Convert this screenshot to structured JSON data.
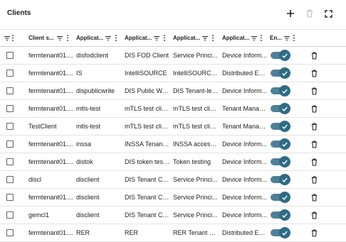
{
  "title": "Clients",
  "toolbar": {
    "add_icon": "plus-icon",
    "delete_icon": "trash-icon",
    "fullscreen_icon": "fullscreen-icon"
  },
  "columns": [
    "Client s...",
    "Applicat...",
    "Applicat...",
    "Applicat...",
    "Applicat...",
    "En..."
  ],
  "colors": {
    "toggle_track": "#4e8098",
    "toggle_knob": "#2f6b85"
  },
  "rows": [
    {
      "client": "fermtenant01....",
      "app_id": "disfodclient",
      "app_name": "DIS FOD Client",
      "app_desc": "Service Princi...",
      "app_sys": "Device Inform...",
      "enabled": true
    },
    {
      "client": "fermtenant01....",
      "app_id": "IS",
      "app_name": "IntelliSOURCE",
      "app_desc": "IntelliSOURCE ...",
      "app_sys": "Distributed En...",
      "enabled": true
    },
    {
      "client": "fermtenant01....",
      "app_id": "dispublicwrite",
      "app_name": "DIS Public Write",
      "app_desc": "DIS Tenant-lev...",
      "app_sys": "Device Inform...",
      "enabled": true
    },
    {
      "client": "fermtenant01....",
      "app_id": "mtls-test",
      "app_name": "mTLS test clie...",
      "app_desc": "mTLS test clie...",
      "app_sys": "Tenant Manag...",
      "enabled": true
    },
    {
      "client": "TestClient",
      "app_id": "mtls-test",
      "app_name": "mTLS test clie...",
      "app_desc": "mTLS test clie...",
      "app_sys": "Tenant Manag...",
      "enabled": true
    },
    {
      "client": "fermtenant01....",
      "app_id": "inssa",
      "app_name": "INSSA Tenant ...",
      "app_desc": "INSSA access ...",
      "app_sys": "Device Inform...",
      "enabled": true
    },
    {
      "client": "fermtenant01....",
      "app_id": "distok",
      "app_name": "DIS token tester",
      "app_desc": "Token testing",
      "app_sys": "Device Inform...",
      "enabled": true
    },
    {
      "client": "discl",
      "app_id": "disclient",
      "app_name": "DIS Tenant Cli...",
      "app_desc": "Service Princi...",
      "app_sys": "Device Inform...",
      "enabled": true
    },
    {
      "client": "fermtenant01....",
      "app_id": "disclient",
      "app_name": "DIS Tenant Cli...",
      "app_desc": "Service Princi...",
      "app_sys": "Device Inform...",
      "enabled": true
    },
    {
      "client": "gemcl1",
      "app_id": "disclient",
      "app_name": "DIS Tenant Cli...",
      "app_desc": "Service Princi...",
      "app_sys": "Device Inform...",
      "enabled": true
    },
    {
      "client": "fermtenant01....",
      "app_id": "RER",
      "app_name": "RER",
      "app_desc": "RER Tenant Cli...",
      "app_sys": "Distributed En...",
      "enabled": true
    }
  ]
}
